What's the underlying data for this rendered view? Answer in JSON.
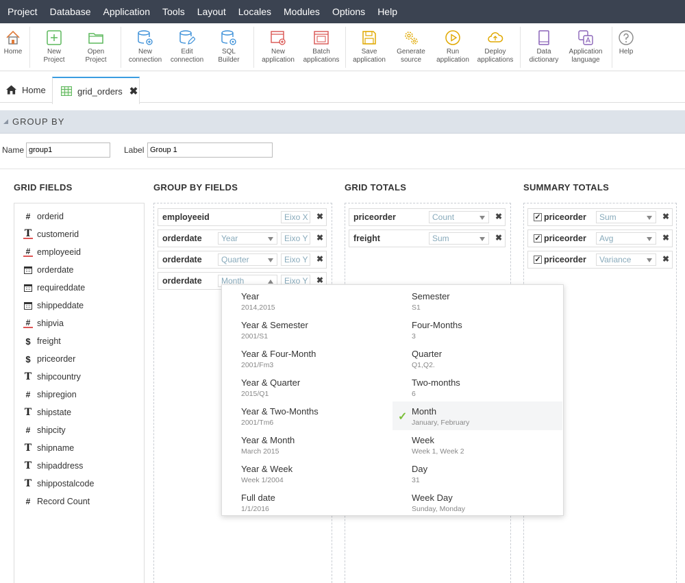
{
  "menu": [
    "Project",
    "Database",
    "Application",
    "Tools",
    "Layout",
    "Locales",
    "Modules",
    "Options",
    "Help"
  ],
  "toolbar": {
    "home": "Home",
    "new_project": [
      "New",
      "Project"
    ],
    "open_project": [
      "Open",
      "Project"
    ],
    "new_connection": [
      "New",
      "connection"
    ],
    "edit_connection": [
      "Edit",
      "connection"
    ],
    "sql_builder": [
      "SQL",
      "Builder"
    ],
    "new_application": [
      "New",
      "application"
    ],
    "batch_applications": [
      "Batch",
      "applications"
    ],
    "save_application": [
      "Save",
      "application"
    ],
    "generate_source": [
      "Generate",
      "source"
    ],
    "run_application": [
      "Run",
      "application"
    ],
    "deploy_applications": [
      "Deploy",
      "applications"
    ],
    "data_dictionary": [
      "Data",
      "dictionary"
    ],
    "application_language": [
      "Application",
      "language"
    ],
    "help": "Help"
  },
  "tabs": {
    "home": "Home",
    "active": "grid_orders"
  },
  "section": {
    "title": "GROUP BY"
  },
  "form": {
    "name_label": "Name",
    "name_value": "group1",
    "label_label": "Label",
    "label_value": "Group 1"
  },
  "columns": {
    "grid_fields": "GRID FIELDS",
    "group_by_fields": "GROUP BY FIELDS",
    "grid_totals": "GRID TOTALS",
    "summary_totals": "SUMMARY TOTALS"
  },
  "grid_fields": [
    {
      "name": "orderid",
      "icon": "#"
    },
    {
      "name": "customerid",
      "icon": "T"
    },
    {
      "name": "employeeid",
      "icon": "#"
    },
    {
      "name": "orderdate",
      "icon": "calendar"
    },
    {
      "name": "requireddate",
      "icon": "calendar"
    },
    {
      "name": "shippeddate",
      "icon": "calendar"
    },
    {
      "name": "shipvia",
      "icon": "#"
    },
    {
      "name": "freight",
      "icon": "$"
    },
    {
      "name": "priceorder",
      "icon": "$"
    },
    {
      "name": "shipcountry",
      "icon": "T"
    },
    {
      "name": "shipregion",
      "icon": "#"
    },
    {
      "name": "shipstate",
      "icon": "T"
    },
    {
      "name": "shipcity",
      "icon": "#"
    },
    {
      "name": "shipname",
      "icon": "T"
    },
    {
      "name": "shipaddress",
      "icon": "T"
    },
    {
      "name": "shippostalcode",
      "icon": "T"
    },
    {
      "name": "Record Count",
      "icon": "#"
    }
  ],
  "group_by_fields": [
    {
      "name": "employeeid",
      "option": "",
      "axis": "Eixo X"
    },
    {
      "name": "orderdate",
      "option": "Year",
      "axis": "Eixo Y"
    },
    {
      "name": "orderdate",
      "option": "Quarter",
      "axis": "Eixo Y"
    },
    {
      "name": "orderdate",
      "option": "Month",
      "axis": "Eixo Y"
    }
  ],
  "grid_totals": [
    {
      "name": "priceorder",
      "fn": "Count"
    },
    {
      "name": "freight",
      "fn": "Sum"
    }
  ],
  "summary_totals": [
    {
      "name": "priceorder",
      "fn": "Sum"
    },
    {
      "name": "priceorder",
      "fn": "Avg"
    },
    {
      "name": "priceorder",
      "fn": "Variance"
    }
  ],
  "date_options_left": [
    {
      "title": "Year",
      "sub": "2014,2015"
    },
    {
      "title": "Year & Semester",
      "sub": "2001/S1"
    },
    {
      "title": "Year & Four-Month",
      "sub": "2001/Fm3"
    },
    {
      "title": "Year & Quarter",
      "sub": "2015/Q1"
    },
    {
      "title": "Year & Two-Months",
      "sub": "2001/Tm6"
    },
    {
      "title": "Year & Month",
      "sub": "March 2015"
    },
    {
      "title": "Year & Week",
      "sub": "Week 1/2004"
    },
    {
      "title": "Full date",
      "sub": "1/1/2016"
    }
  ],
  "date_options_right": [
    {
      "title": "Semester",
      "sub": "S1"
    },
    {
      "title": "Four-Months",
      "sub": "3"
    },
    {
      "title": "Quarter",
      "sub": "Q1,Q2."
    },
    {
      "title": "Two-months",
      "sub": "6"
    },
    {
      "title": "Month",
      "sub": "January, February",
      "selected": true
    },
    {
      "title": "Week",
      "sub": "Week 1, Week 2"
    },
    {
      "title": "Day",
      "sub": "31"
    },
    {
      "title": "Week Day",
      "sub": "Sunday, Monday"
    }
  ],
  "colors": {
    "menubar": "#3b4351",
    "accent": "#3a9de0",
    "check": "#7bbf3a"
  }
}
